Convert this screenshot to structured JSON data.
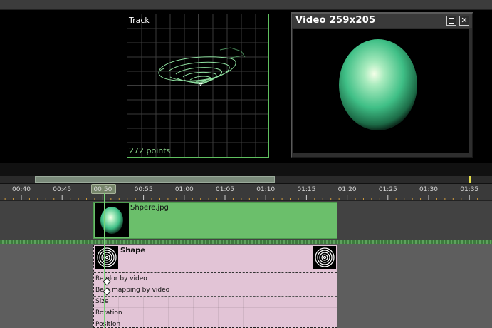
{
  "track_panel": {
    "title": "Track",
    "point_count": "272 points"
  },
  "video_window": {
    "title": "Video 259x205",
    "close_glyph": "✕"
  },
  "timeline": {
    "ruler_labels": [
      "00:40",
      "00:45",
      "00:50",
      "00:55",
      "01:00",
      "01:05",
      "01:10",
      "01:15",
      "01:20",
      "01:25",
      "01:30",
      "01:35"
    ]
  },
  "video_clip": {
    "name": "Shpere.jpg"
  },
  "shape_clip": {
    "title": "Shape",
    "params": [
      "Re olor by video",
      "Be p mapping by video",
      "Size",
      "Rotation",
      "Position"
    ]
  },
  "colors": {
    "clip_green": "#6bbf6b",
    "shape_pink": "#e2c4d6",
    "track_border": "#5fbf5f",
    "sphere_color": "#3fbf86"
  },
  "icons": [
    "restore-icon",
    "close-icon",
    "spiral-shape-icon"
  ]
}
